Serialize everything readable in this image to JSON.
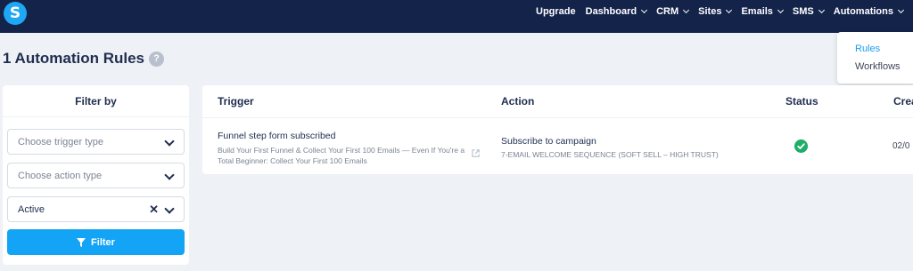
{
  "app": {
    "logo_letter": "S"
  },
  "nav": {
    "items": [
      {
        "label": "Upgrade",
        "has_caret": false
      },
      {
        "label": "Dashboard",
        "has_caret": true
      },
      {
        "label": "CRM",
        "has_caret": true
      },
      {
        "label": "Sites",
        "has_caret": true
      },
      {
        "label": "Emails",
        "has_caret": true
      },
      {
        "label": "SMS",
        "has_caret": true
      },
      {
        "label": "Automations",
        "has_caret": true
      }
    ]
  },
  "automations_menu": {
    "items": [
      "Rules",
      "Workflows"
    ]
  },
  "page": {
    "title": "1 Automation Rules",
    "help": "?"
  },
  "filter": {
    "heading": "Filter by",
    "trigger_type_placeholder": "Choose trigger type",
    "action_type_placeholder": "Choose action type",
    "status_value": "Active",
    "clear_glyph": "✕",
    "button_label": "Filter"
  },
  "table": {
    "columns": [
      "Trigger",
      "Action",
      "Status",
      "Crea"
    ],
    "rows": [
      {
        "trigger_title": "Funnel step form subscribed",
        "trigger_detail": "Build Your First Funnel & Collect Your First 100 Emails — Even If You're a Total Beginner: Collect Your First 100 Emails",
        "action_title": "Subscribe to campaign",
        "action_detail": "7-EMAIL WELCOME SEQUENCE (SOFT SELL – HIGH TRUST)",
        "status": "active",
        "created": "02/0"
      }
    ]
  },
  "colors": {
    "nav_bg": "#14234a",
    "accent": "#14a4f5",
    "link": "#1e9cf0",
    "status_active": "#1fae6a",
    "page_bg": "#eef1f5"
  },
  "icons": {
    "logo": "logo-s-icon",
    "help": "question-circle-icon",
    "caret": "chevron-down-icon",
    "clear": "close-icon",
    "filter": "funnel-icon",
    "external": "external-link-icon",
    "status": "check-circle-icon"
  }
}
